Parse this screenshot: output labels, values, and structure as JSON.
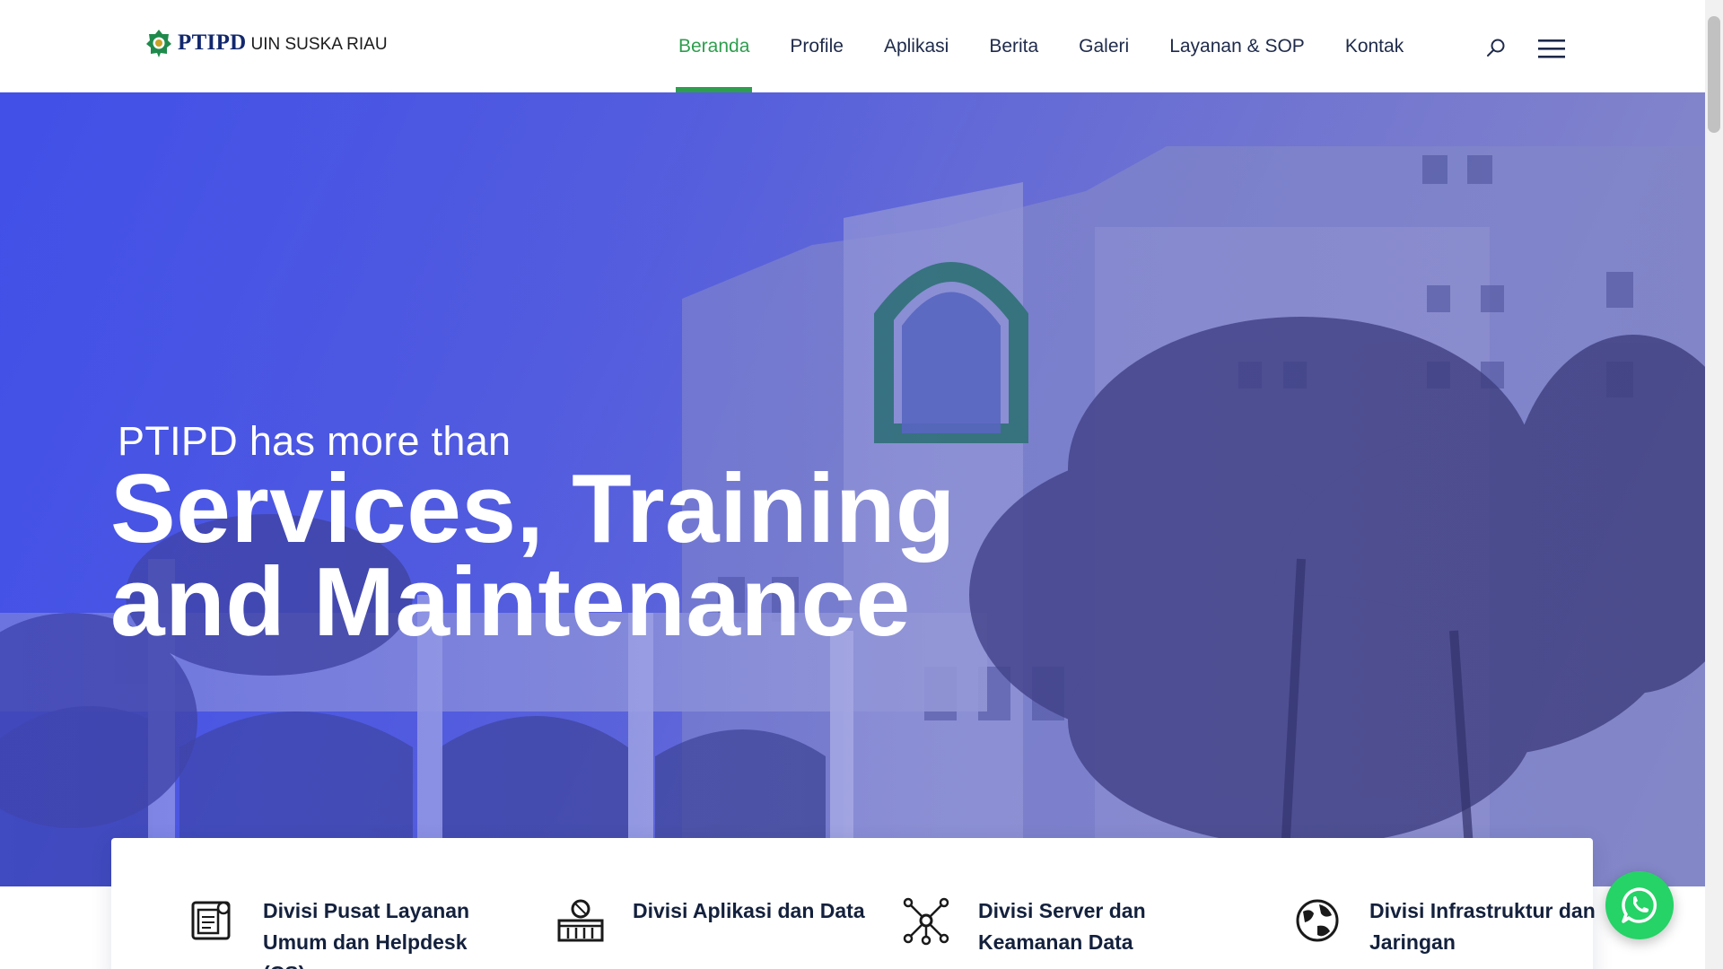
{
  "header": {
    "logo": {
      "brand": "PTIPD",
      "subtitle": "UIN SUSKA RIAU"
    },
    "nav": [
      {
        "label": "Beranda",
        "active": true
      },
      {
        "label": "Profile",
        "active": false
      },
      {
        "label": "Aplikasi",
        "active": false
      },
      {
        "label": "Berita",
        "active": false
      },
      {
        "label": "Galeri",
        "active": false
      },
      {
        "label": "Layanan & SOP",
        "active": false
      },
      {
        "label": "Kontak",
        "active": false
      }
    ],
    "search_icon": "search-icon",
    "menu_icon": "hamburger-menu-icon"
  },
  "hero": {
    "kicker": "PTIPD has more than",
    "title_line1": "Services, Training",
    "title_line2": "and Maintenance"
  },
  "divisions": [
    {
      "label": "Divisi Pusat Layanan Umum dan Helpdesk (CS)",
      "icon": "helpdesk-document-icon"
    },
    {
      "label": "Divisi Aplikasi dan Data",
      "icon": "data-server-icon"
    },
    {
      "label": "Divisi Server dan Keamanan Data",
      "icon": "network-nodes-icon"
    },
    {
      "label": "Divisi Infrastruktur dan Jaringan",
      "icon": "globe-icon"
    }
  ],
  "floating": {
    "whatsapp_icon": "whatsapp-icon"
  },
  "colors": {
    "accent": "#2e9e4e",
    "brand_blue": "#12286e",
    "hero_tint": "#4152ea",
    "whatsapp": "#25d366"
  }
}
